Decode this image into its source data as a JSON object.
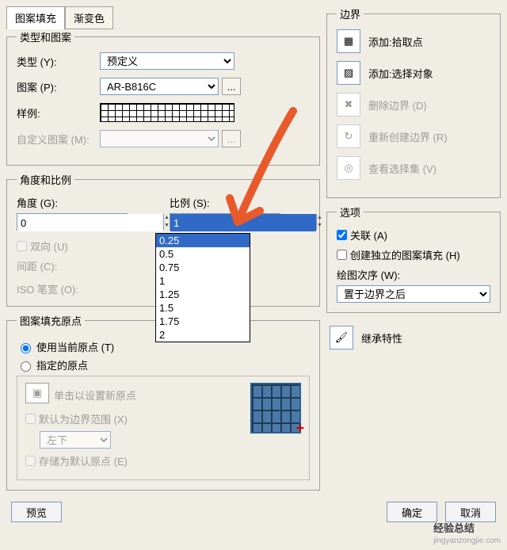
{
  "tabs": {
    "pattern_fill": "图案填充",
    "gradient": "渐变色"
  },
  "group_type": {
    "legend": "类型和图案",
    "type_label": "类型 (Y):",
    "type_value": "预定义",
    "pattern_label": "图案 (P):",
    "pattern_value": "AR-B816C",
    "sample_label": "样例:",
    "custom_label": "自定义图案 (M):"
  },
  "group_angle": {
    "legend": "角度和比例",
    "angle_label": "角度 (G):",
    "angle_value": "0",
    "scale_label": "比例 (S):",
    "scale_value": "1",
    "options": [
      "0.25",
      "0.5",
      "0.75",
      "1",
      "1.25",
      "1.5",
      "1.75",
      "2"
    ],
    "selected_option": "0.25",
    "double_label": "双向 (U)",
    "spacing_label": "间距 (C):",
    "iso_label": "ISO 笔宽 (O):"
  },
  "group_origin": {
    "legend": "图案填充原点",
    "use_current": "使用当前原点 (T)",
    "specified": "指定的原点",
    "click_set": "单击以设置新原点",
    "default_extent": "默认为边界范围 (X)",
    "pos_value": "左下",
    "store_default": "存储为默认原点 (E)"
  },
  "boundary": {
    "legend": "边界",
    "add_pick": "添加:拾取点",
    "add_select": "添加:选择对象",
    "del_boundary": "删除边界 (D)",
    "recreate": "重新创建边界 (R)",
    "view_sel": "查看选择集 (V)"
  },
  "options": {
    "legend": "选项",
    "assoc": "关联 (A)",
    "independent": "创建独立的图案填充 (H)",
    "draw_order_label": "绘图次序 (W):",
    "draw_order_value": "置于边界之后"
  },
  "inherit": "继承特性",
  "buttons": {
    "preview": "预览",
    "ok": "确定",
    "cancel": "取消"
  },
  "watermark": "经验总结",
  "watermark_sub": "jingyanzongjie.com"
}
